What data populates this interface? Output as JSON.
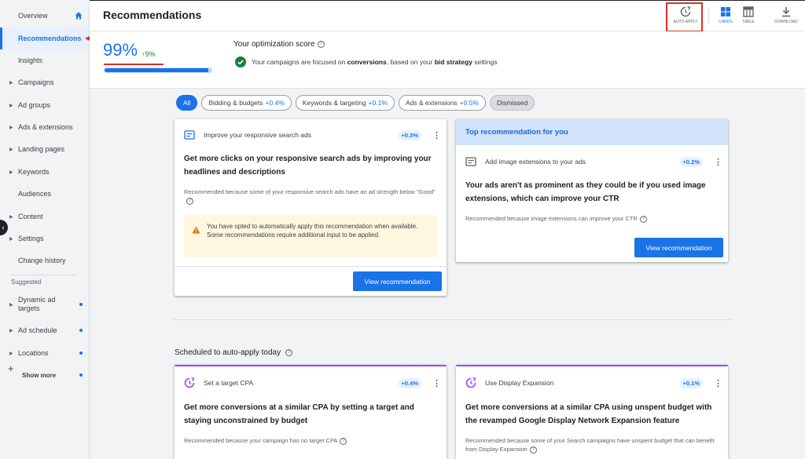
{
  "sidebar": {
    "items": [
      {
        "label": "Overview"
      },
      {
        "label": "Recommendations"
      },
      {
        "label": "Insights"
      },
      {
        "label": "Campaigns"
      },
      {
        "label": "Ad groups"
      },
      {
        "label": "Ads & extensions"
      },
      {
        "label": "Landing pages"
      },
      {
        "label": "Keywords"
      },
      {
        "label": "Audiences"
      },
      {
        "label": "Content"
      },
      {
        "label": "Settings"
      },
      {
        "label": "Change history"
      }
    ],
    "suggested_heading": "Suggested",
    "suggested": [
      {
        "label": "Dynamic ad targets"
      },
      {
        "label": "Ad schedule"
      },
      {
        "label": "Locations"
      },
      {
        "label": "Show more"
      }
    ]
  },
  "header": {
    "title": "Recommendations",
    "tools": {
      "auto_apply": "AUTO-APPLY",
      "cards": "CARDS",
      "table": "TABLE",
      "download": "DOWNLOAD"
    }
  },
  "score": {
    "value": "99%",
    "delta": "9%",
    "progress_fraction": 0.99,
    "heading": "Your optimization score",
    "message_pre": "Your campaigns are focused on",
    "message_bold1": "conversions",
    "message_mid": ", based on your",
    "message_bold2": "bid strategy",
    "message_post": "settings"
  },
  "filters": [
    {
      "label": "All",
      "pct": ""
    },
    {
      "label": "Bidding & budgets",
      "pct": "+0.4%"
    },
    {
      "label": "Keywords & targeting",
      "pct": "+0.1%"
    },
    {
      "label": "Ads & extensions",
      "pct": "+0.5%"
    },
    {
      "label": "Dismissed",
      "pct": ""
    }
  ],
  "cards": {
    "rsa": {
      "title": "Improve your responsive search ads",
      "badge": "+0.3%",
      "main": "Get more clicks on your responsive search ads by improving your headlines and descriptions",
      "reason": "Recommended because some of your responsive search ads have an ad strength below \"Good\"",
      "notice": "You have opted to automatically apply this recommendation when available. Some recommendations require additional input to be applied.",
      "button": "View recommendation"
    },
    "image_ext": {
      "banner": "Top recommendation for you",
      "title": "Add image extensions to your ads",
      "badge": "+0.2%",
      "main": "Your ads aren't as prominent as they could be if you used image extensions, which can improve your CTR",
      "reason": "Recommended because image extensions can improve your CTR",
      "button": "View recommendation"
    }
  },
  "scheduled": {
    "heading": "Scheduled to auto-apply today",
    "cards": [
      {
        "title": "Set a target CPA",
        "badge": "+0.4%",
        "main": "Get more conversions at a similar CPA by setting a target and staying unconstrained by budget",
        "reason": "Recommended because your campaign has no target CPA"
      },
      {
        "title": "Use Display Expansion",
        "badge": "+0.1%",
        "main": "Get more conversions at a similar CPA using unspent budget with the revamped Google Display Network Expansion feature",
        "reason": "Recommended because some of your Search campaigns have unspent budget that can benefit from Display Expansion"
      }
    ]
  },
  "colors": {
    "accent": "#1a73e8",
    "annotation": "#d93025",
    "positive": "#188038",
    "auto_apply_purple": "#a142f4"
  }
}
